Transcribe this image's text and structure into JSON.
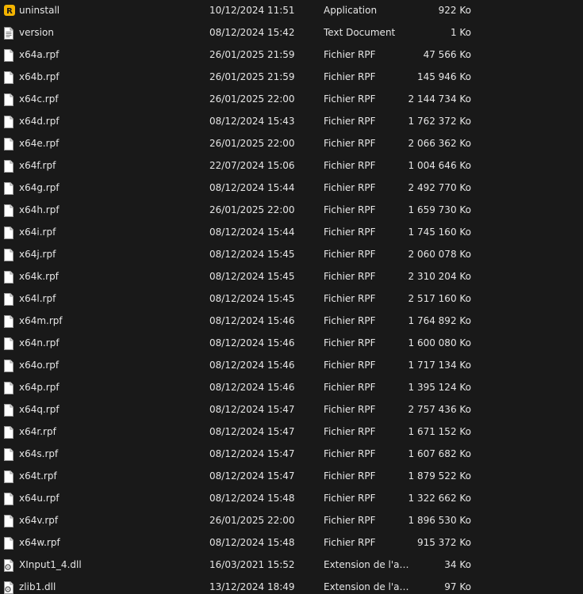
{
  "files": [
    {
      "icon": "rockstar-app-icon",
      "name": "uninstall",
      "date": "10/12/2024 11:51",
      "type": "Application",
      "size": "922 Ko"
    },
    {
      "icon": "text-document-icon",
      "name": "version",
      "date": "08/12/2024 15:42",
      "type": "Text Document",
      "size": "1 Ko"
    },
    {
      "icon": "file-icon",
      "name": "x64a.rpf",
      "date": "26/01/2025 21:59",
      "type": "Fichier RPF",
      "size": "47 566 Ko"
    },
    {
      "icon": "file-icon",
      "name": "x64b.rpf",
      "date": "26/01/2025 21:59",
      "type": "Fichier RPF",
      "size": "145 946 Ko"
    },
    {
      "icon": "file-icon",
      "name": "x64c.rpf",
      "date": "26/01/2025 22:00",
      "type": "Fichier RPF",
      "size": "2 144 734 Ko"
    },
    {
      "icon": "file-icon",
      "name": "x64d.rpf",
      "date": "08/12/2024 15:43",
      "type": "Fichier RPF",
      "size": "1 762 372 Ko"
    },
    {
      "icon": "file-icon",
      "name": "x64e.rpf",
      "date": "26/01/2025 22:00",
      "type": "Fichier RPF",
      "size": "2 066 362 Ko"
    },
    {
      "icon": "file-icon",
      "name": "x64f.rpf",
      "date": "22/07/2024 15:06",
      "type": "Fichier RPF",
      "size": "1 004 646 Ko"
    },
    {
      "icon": "file-icon",
      "name": "x64g.rpf",
      "date": "08/12/2024 15:44",
      "type": "Fichier RPF",
      "size": "2 492 770 Ko"
    },
    {
      "icon": "file-icon",
      "name": "x64h.rpf",
      "date": "26/01/2025 22:00",
      "type": "Fichier RPF",
      "size": "1 659 730 Ko"
    },
    {
      "icon": "file-icon",
      "name": "x64i.rpf",
      "date": "08/12/2024 15:44",
      "type": "Fichier RPF",
      "size": "1 745 160 Ko"
    },
    {
      "icon": "file-icon",
      "name": "x64j.rpf",
      "date": "08/12/2024 15:45",
      "type": "Fichier RPF",
      "size": "2 060 078 Ko"
    },
    {
      "icon": "file-icon",
      "name": "x64k.rpf",
      "date": "08/12/2024 15:45",
      "type": "Fichier RPF",
      "size": "2 310 204 Ko"
    },
    {
      "icon": "file-icon",
      "name": "x64l.rpf",
      "date": "08/12/2024 15:45",
      "type": "Fichier RPF",
      "size": "2 517 160 Ko"
    },
    {
      "icon": "file-icon",
      "name": "x64m.rpf",
      "date": "08/12/2024 15:46",
      "type": "Fichier RPF",
      "size": "1 764 892 Ko"
    },
    {
      "icon": "file-icon",
      "name": "x64n.rpf",
      "date": "08/12/2024 15:46",
      "type": "Fichier RPF",
      "size": "1 600 080 Ko"
    },
    {
      "icon": "file-icon",
      "name": "x64o.rpf",
      "date": "08/12/2024 15:46",
      "type": "Fichier RPF",
      "size": "1 717 134 Ko"
    },
    {
      "icon": "file-icon",
      "name": "x64p.rpf",
      "date": "08/12/2024 15:46",
      "type": "Fichier RPF",
      "size": "1 395 124 Ko"
    },
    {
      "icon": "file-icon",
      "name": "x64q.rpf",
      "date": "08/12/2024 15:47",
      "type": "Fichier RPF",
      "size": "2 757 436 Ko"
    },
    {
      "icon": "file-icon",
      "name": "x64r.rpf",
      "date": "08/12/2024 15:47",
      "type": "Fichier RPF",
      "size": "1 671 152 Ko"
    },
    {
      "icon": "file-icon",
      "name": "x64s.rpf",
      "date": "08/12/2024 15:47",
      "type": "Fichier RPF",
      "size": "1 607 682 Ko"
    },
    {
      "icon": "file-icon",
      "name": "x64t.rpf",
      "date": "08/12/2024 15:47",
      "type": "Fichier RPF",
      "size": "1 879 522 Ko"
    },
    {
      "icon": "file-icon",
      "name": "x64u.rpf",
      "date": "08/12/2024 15:48",
      "type": "Fichier RPF",
      "size": "1 322 662 Ko"
    },
    {
      "icon": "file-icon",
      "name": "x64v.rpf",
      "date": "26/01/2025 22:00",
      "type": "Fichier RPF",
      "size": "1 896 530 Ko"
    },
    {
      "icon": "file-icon",
      "name": "x64w.rpf",
      "date": "08/12/2024 15:48",
      "type": "Fichier RPF",
      "size": "915 372 Ko"
    },
    {
      "icon": "dll-gear-icon",
      "name": "XInput1_4.dll",
      "date": "16/03/2021 15:52",
      "type": "Extension de l'application",
      "size": "34 Ko"
    },
    {
      "icon": "dll-gear-icon",
      "name": "zlib1.dll",
      "date": "13/12/2024 18:49",
      "type": "Extension de l'application",
      "size": "97 Ko"
    }
  ]
}
